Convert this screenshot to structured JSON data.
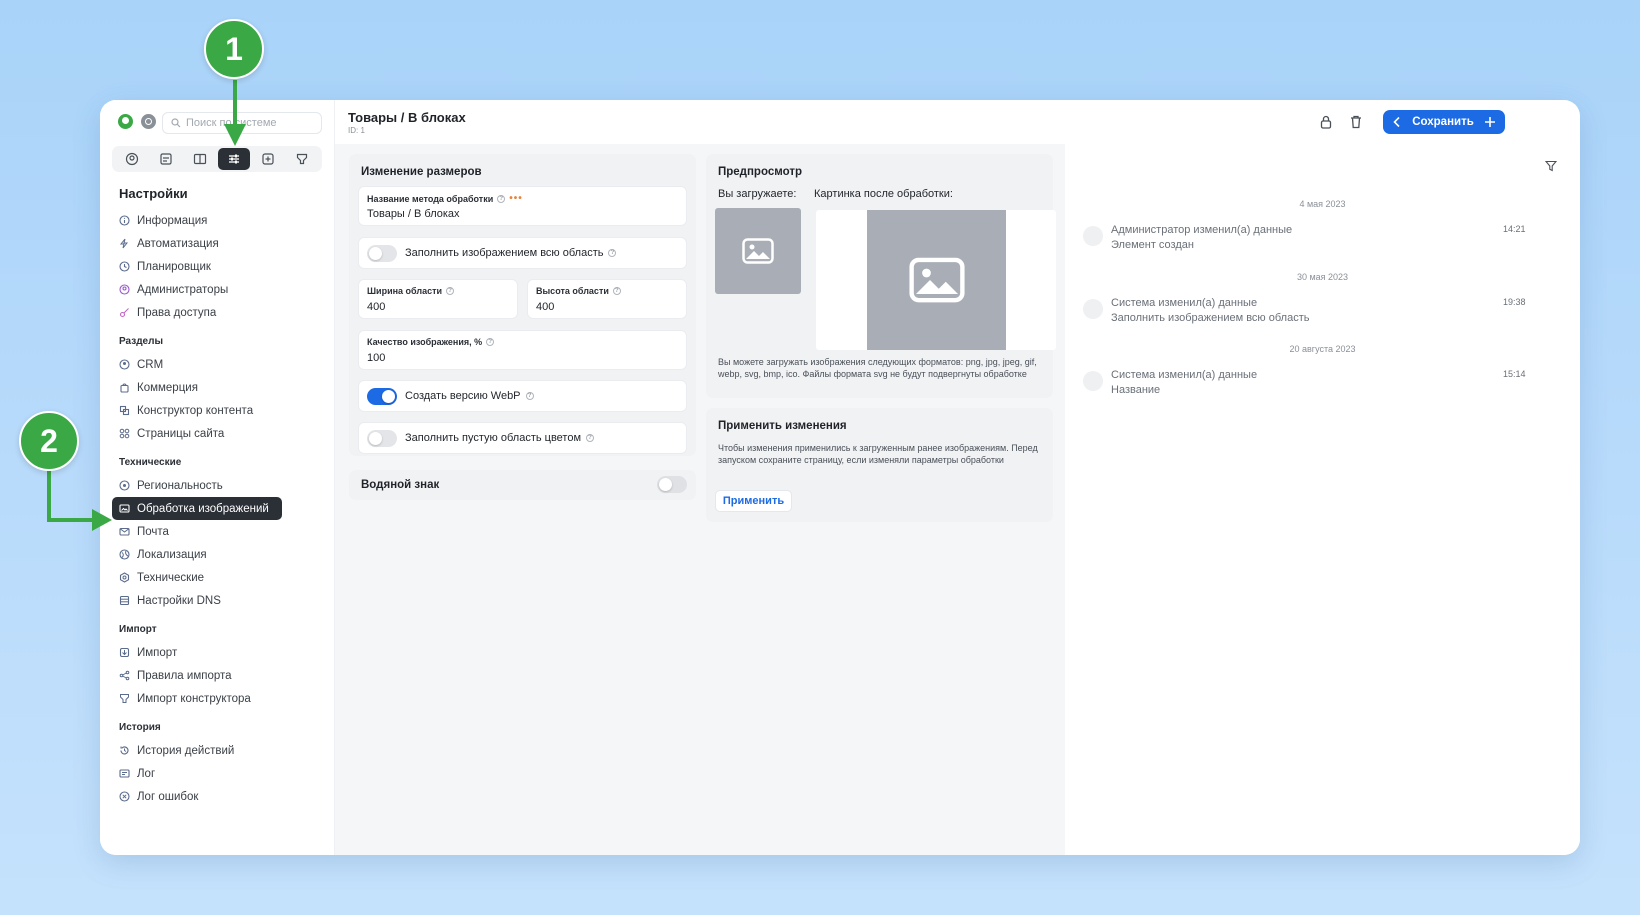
{
  "header": {
    "title": "Товары / В блоках",
    "id": "ID: 1",
    "save_label": "Сохранить"
  },
  "search": {
    "placeholder": "Поиск по системе"
  },
  "sidebar": {
    "heading": "Настройки",
    "settings": [
      "Информация",
      "Автоматизация",
      "Планировщик",
      "Администраторы",
      "Права доступа"
    ],
    "sections": [
      {
        "title": "Разделы",
        "items": [
          "CRM",
          "Коммерция",
          "Конструктор контента",
          "Страницы сайта"
        ]
      },
      {
        "title": "Технические",
        "items": [
          "Региональность",
          "Обработка изображений",
          "Почта",
          "Локализация",
          "Технические",
          "Настройки DNS"
        ]
      },
      {
        "title": "Импорт",
        "items": [
          "Импорт",
          "Правила импорта",
          "Импорт конструктора"
        ]
      },
      {
        "title": "История",
        "items": [
          "История действий",
          "Лог",
          "Лог ошибок"
        ]
      }
    ],
    "active_item": "Обработка изображений"
  },
  "resize": {
    "title": "Изменение размеров",
    "method_label": "Название метода обработки",
    "method_value": "Товары / В блоках",
    "fill_label": "Заполнить изображением всю область",
    "width_label": "Ширина области",
    "width_value": "400",
    "height_label": "Высота области",
    "height_value": "400",
    "quality_label": "Качество изображения, %",
    "quality_value": "100",
    "webp_label": "Создать версию WebP",
    "webp_on": true,
    "fillcolor_label": "Заполнить пустую область цветом",
    "fill_on": false,
    "fillcolor_on": false
  },
  "watermark": {
    "label": "Водяной знак",
    "on": false
  },
  "preview": {
    "title": "Предпросмотр",
    "upload_label": "Вы загружаете:",
    "after_label": "Картинка после обработки:",
    "note": "Вы можете загружать изображения следующих форматов: png, jpg, jpeg, gif, webp, svg, bmp, ico. Файлы формата svg не будут подвергнуты обработке"
  },
  "apply": {
    "title": "Применить изменения",
    "note": "Чтобы изменения применились к загруженным ранее изображениям. Перед запуском сохраните страницу, если изменяли параметры обработки",
    "button": "Применить"
  },
  "history": [
    {
      "date": "4 мая 2023",
      "line1": "Администратор изменил(а) данные",
      "line2": "Элемент создан",
      "time": "14:21"
    },
    {
      "date": "30 мая 2023",
      "line1": "Система изменил(а) данные",
      "line2": "Заполнить изображением всю область",
      "time": "19:38"
    },
    {
      "date": "20 августа 2023",
      "line1": "Система изменил(а) данные",
      "line2": "Название",
      "time": "15:14"
    }
  ],
  "markers": [
    "1",
    "2"
  ],
  "colors": {
    "accent": "#1c6ae4",
    "marker": "#3aa845",
    "active_nav": "#2b2f36"
  }
}
